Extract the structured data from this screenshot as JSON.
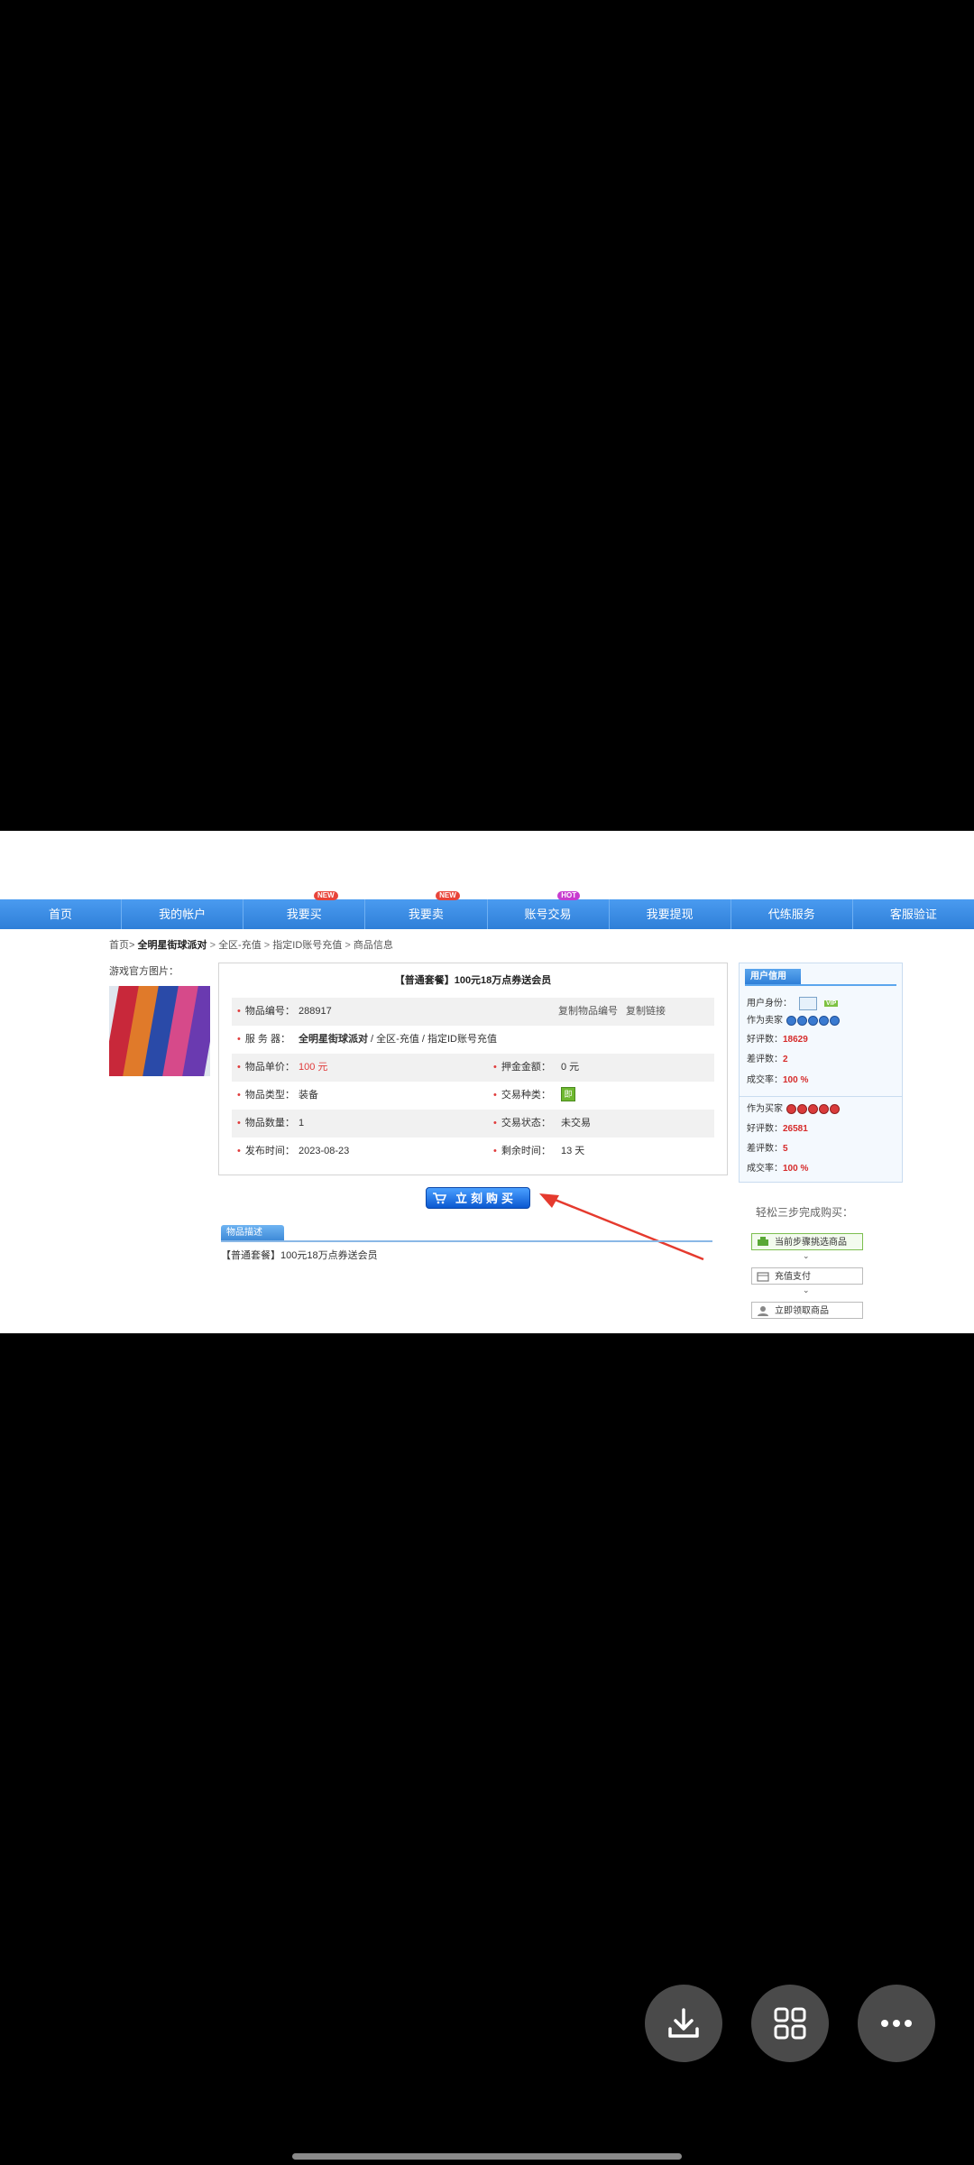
{
  "nav": {
    "items": [
      {
        "label": "首页",
        "badge": ""
      },
      {
        "label": "我的帐户",
        "badge": ""
      },
      {
        "label": "我要买",
        "badge": "NEW"
      },
      {
        "label": "我要卖",
        "badge": "NEW"
      },
      {
        "label": "账号交易",
        "badge": "HOT"
      },
      {
        "label": "我要提现",
        "badge": ""
      },
      {
        "label": "代练服务",
        "badge": ""
      },
      {
        "label": "客服验证",
        "badge": ""
      }
    ]
  },
  "breadcrumb": {
    "home": "首页>",
    "game": "全明星街球派对",
    "sep1": ">",
    "region": "全区-充值",
    "sep2": ">",
    "category": "指定ID账号充值",
    "sep3": ">",
    "current": "商品信息"
  },
  "left": {
    "pic_label": "游戏官方图片："
  },
  "detail": {
    "title": "【普通套餐】100元18万点券送会员",
    "item_no_label": "物品编号：",
    "item_no": "288917",
    "copy_no": "复制物品编号",
    "copy_link": "复制链接",
    "server_label": "服 务 器：",
    "server_game": "全明星街球派对",
    "server_rest": " / 全区-充值 / 指定ID账号充值",
    "price_label": "物品单价：",
    "price": "100 元",
    "deposit_label": "押金金额：",
    "deposit": "0 元",
    "type_label": "物品类型：",
    "type": "装备",
    "trade_kind_label": "交易种类：",
    "trade_kind_icon": "即",
    "qty_label": "物品数量：",
    "qty": "1",
    "trade_status_label": "交易状态：",
    "trade_status": "未交易",
    "publish_label": "发布时间：",
    "publish": "2023-08-23",
    "remain_label": "剩余时间：",
    "remain": "13 天"
  },
  "buy_button": "立刻购买",
  "description": {
    "tab": "物品描述",
    "text": "【普通套餐】100元18万点券送会员"
  },
  "credit": {
    "title": "用户信用",
    "identity_label": "用户身份：",
    "vip": "VIP",
    "as_seller": "作为卖家",
    "seller_good_label": "好评数：",
    "seller_good": "18629",
    "seller_bad_label": "差评数：",
    "seller_bad": "2",
    "seller_rate_label": "成交率：",
    "seller_rate": "100 %",
    "as_buyer": "作为买家",
    "buyer_good_label": "好评数：",
    "buyer_good": "26581",
    "buyer_bad_label": "差评数：",
    "buyer_bad": "5",
    "buyer_rate_label": "成交率：",
    "buyer_rate": "100 %"
  },
  "steps": {
    "title": "轻松三步完成购买：",
    "items": [
      "当前步骤挑选商品",
      "充值支付",
      "立即领取商品"
    ]
  },
  "colors": {
    "nav": "#3a8ee6",
    "accent_red": "#e03b3b",
    "buy": "#0b58d1"
  }
}
